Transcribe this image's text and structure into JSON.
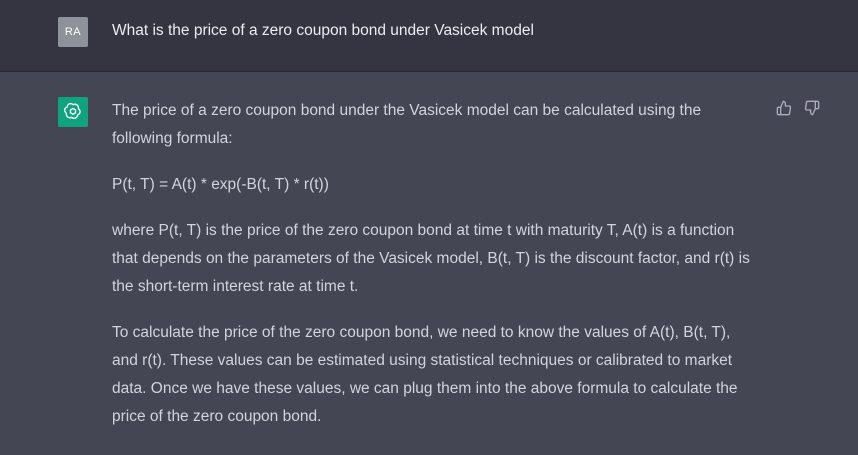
{
  "user_message": {
    "avatar_initials": "RA",
    "text": "What is the price of a zero coupon bond under Vasicek model"
  },
  "assistant_message": {
    "avatar_icon": "openai-logo-icon",
    "paragraphs": [
      "The price of a zero coupon bond under the Vasicek model can be calculated using the following formula:",
      "P(t, T) = A(t) * exp(-B(t, T) * r(t))",
      "where P(t, T) is the price of the zero coupon bond at time t with maturity T, A(t) is a function that depends on the parameters of the Vasicek model, B(t, T) is the discount factor, and r(t) is the short-term interest rate at time t.",
      "To calculate the price of the zero coupon bond, we need to know the values of A(t), B(t, T), and r(t). These values can be estimated using statistical techniques or calibrated to market data. Once we have these values, we can plug them into the above formula to calculate the price of the zero coupon bond."
    ]
  },
  "feedback": {
    "thumbs_up_icon": "thumbs-up-icon",
    "thumbs_down_icon": "thumbs-down-icon"
  },
  "colors": {
    "user_bg": "#343541",
    "assistant_bg": "#444654",
    "avatar_user": "#8e929a",
    "avatar_gpt": "#10a37f",
    "text": "#d1d5db"
  }
}
